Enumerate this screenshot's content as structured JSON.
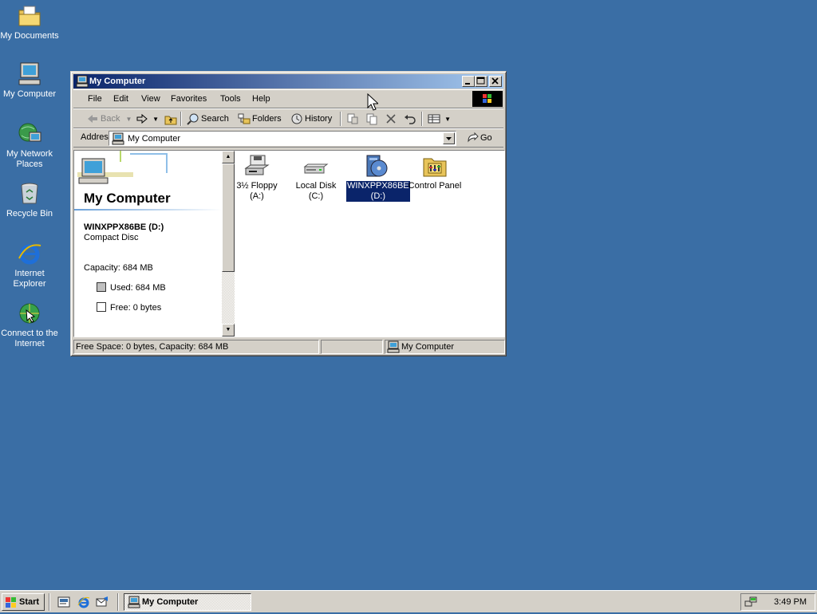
{
  "desktop": {
    "background_color": "#3a6ea5",
    "icons": [
      {
        "label": "My Documents",
        "icon": "folder-documents-icon"
      },
      {
        "label": "My Computer",
        "icon": "computer-icon"
      },
      {
        "label": "My Network Places",
        "icon": "network-places-icon"
      },
      {
        "label": "Recycle Bin",
        "icon": "recycle-bin-icon"
      },
      {
        "label": "Internet Explorer",
        "icon": "internet-explorer-icon"
      },
      {
        "label": "Connect to the Internet",
        "icon": "connect-internet-icon"
      }
    ]
  },
  "window": {
    "title": "My Computer",
    "menu": [
      "File",
      "Edit",
      "View",
      "Favorites",
      "Tools",
      "Help"
    ],
    "toolbar": {
      "back": "Back",
      "search": "Search",
      "folders": "Folders",
      "history": "History"
    },
    "address": {
      "label": "Address",
      "value": "My Computer",
      "go": "Go"
    },
    "left_pane": {
      "heading": "My Computer",
      "item_name": "WINXPPX86BE (D:)",
      "item_type": "Compact Disc",
      "capacity": "Capacity: 684 MB",
      "used": "Used: 684 MB",
      "free": "Free: 0 bytes"
    },
    "items": [
      {
        "label": "3½ Floppy (A:)",
        "icon": "floppy-drive-icon",
        "selected": false
      },
      {
        "label": "Local Disk (C:)",
        "icon": "hard-disk-icon",
        "selected": false
      },
      {
        "label": "WINXPPX86BE (D:)",
        "icon": "cd-drive-icon",
        "selected": true
      },
      {
        "label": "Control Panel",
        "icon": "control-panel-icon",
        "selected": false
      }
    ],
    "status": {
      "left": "Free Space: 0 bytes, Capacity: 684 MB",
      "middle": "",
      "right": "My Computer"
    }
  },
  "taskbar": {
    "start": "Start",
    "quicklaunch": [
      "show-desktop-icon",
      "internet-explorer-icon",
      "outlook-express-icon"
    ],
    "task": "My Computer",
    "clock": "3:49 PM"
  },
  "colors": {
    "titlebar_start": "#0a246a",
    "titlebar_end": "#a6caf0",
    "selection": "#0a246a",
    "chrome": "#d4d0c8"
  }
}
